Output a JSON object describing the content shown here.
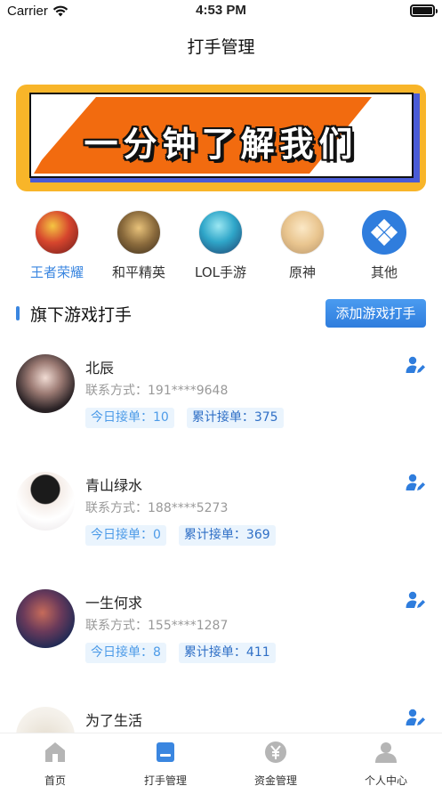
{
  "status_bar": {
    "carrier": "Carrier",
    "time": "4:53 PM"
  },
  "nav": {
    "title": "打手管理"
  },
  "banner": {
    "text": "一分钟了解我们"
  },
  "games": [
    {
      "label": "王者荣耀",
      "active": true,
      "icon": "honor-of-kings-avatar"
    },
    {
      "label": "和平精英",
      "active": false,
      "icon": "peacekeeper-elite-avatar"
    },
    {
      "label": "LOL手游",
      "active": false,
      "icon": "lol-mobile-avatar"
    },
    {
      "label": "原神",
      "active": false,
      "icon": "genshin-avatar"
    },
    {
      "label": "其他",
      "active": false,
      "icon": "other-games-icon"
    }
  ],
  "section": {
    "title": "旗下游戏打手",
    "add_button": "添加游戏打手"
  },
  "players": [
    {
      "name": "北辰",
      "contact": "联系方式：191****9648",
      "today": "今日接单：10",
      "total": "累计接单：375"
    },
    {
      "name": "青山绿水",
      "contact": "联系方式：188****5273",
      "today": "今日接单：0",
      "total": "累计接单：369"
    },
    {
      "name": "一生何求",
      "contact": "联系方式：155****1287",
      "today": "今日接单：8",
      "total": "累计接单：411"
    },
    {
      "name": "为了生活"
    }
  ],
  "tabbar": [
    {
      "label": "首页",
      "icon": "home-icon"
    },
    {
      "label": "打手管理",
      "icon": "player-manage-icon",
      "active": true
    },
    {
      "label": "资金管理",
      "icon": "yuan-icon"
    },
    {
      "label": "个人中心",
      "icon": "profile-icon"
    }
  ],
  "colors": {
    "accent": "#3a86e0",
    "banner_bg": "#f8b529",
    "banner_orange": "#f26b0f",
    "banner_blue": "#4a5bd6"
  }
}
